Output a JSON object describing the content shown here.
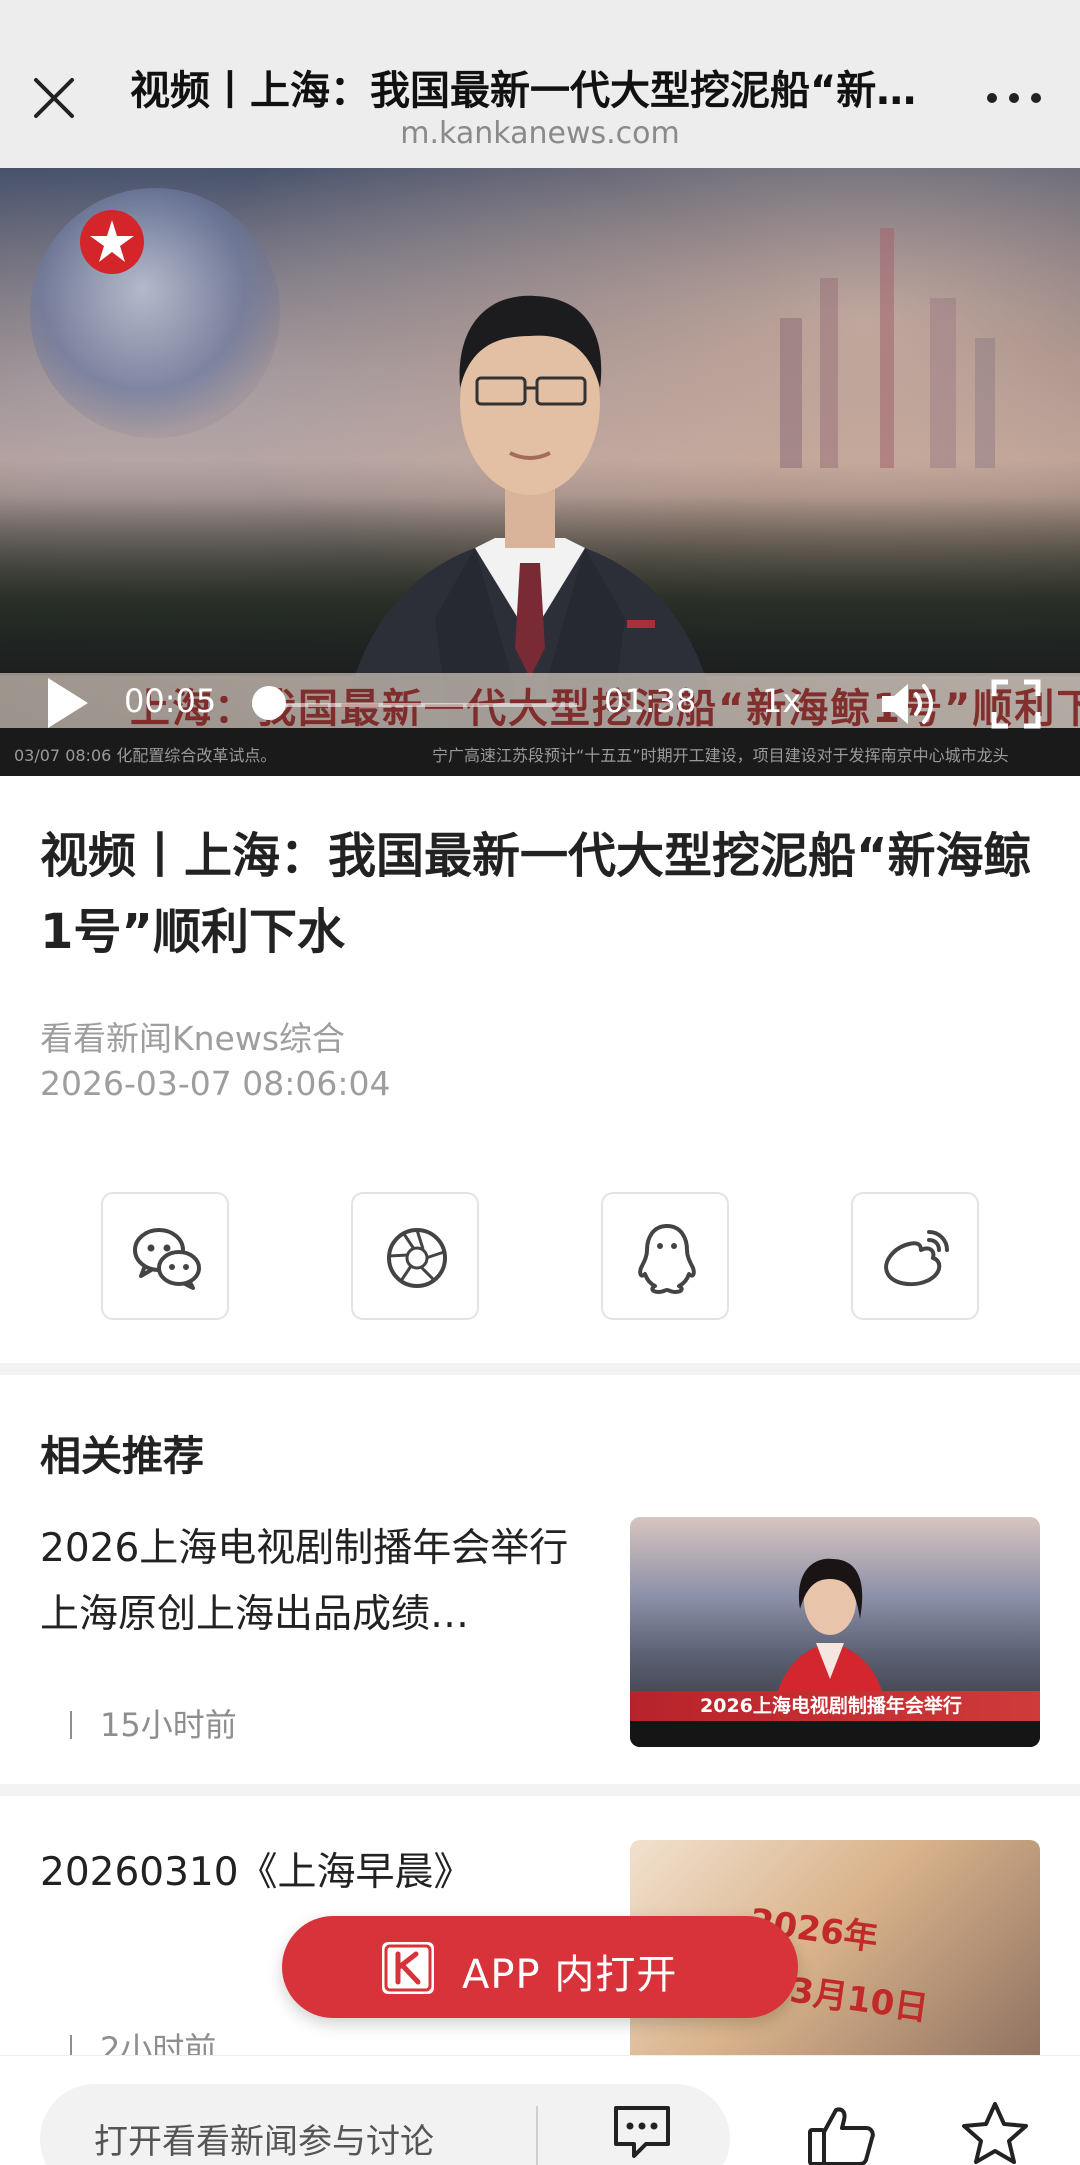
{
  "browser": {
    "page_title": "视频丨上海：我国最新一代大型挖泥船“新海鲸1号”顺利下水",
    "domain": "m.kankanews.com"
  },
  "video": {
    "current_time": "00:05",
    "duration": "01:38",
    "speed": "1x",
    "progress_fraction": 0.051,
    "caption": "上海：我国最新一代大型挖泥船“新海鲸1号”顺利下水",
    "ticker_left": "03/07 08:06 化配置综合改革试点。",
    "ticker_right": "宁广高速江苏段预计“十五五”时期开工建设，项目建设对于发挥南京中心城市龙头"
  },
  "article": {
    "headline": "视频丨上海：我国最新一代大型挖泥船“新海鲸1号”顺利下水",
    "source": "看看新闻Knews综合",
    "date": "2026-03-07 08:06:04"
  },
  "share": {
    "icons": [
      "wechat-icon",
      "moments-icon",
      "qq-icon",
      "weibo-icon"
    ]
  },
  "related": {
    "section_title": "相关推荐",
    "items": [
      {
        "title": "2026上海电视剧制播年会举行 上海原创上海出品成绩…",
        "time": "15小时前",
        "thumb_caption": "2026上海电视剧制播年会举行"
      },
      {
        "title": "20260310《上海早晨》",
        "time": "2小时前",
        "thumb_year": "2026年",
        "thumb_date": "3月10日"
      }
    ]
  },
  "app_button": {
    "label": "APP 内打开"
  },
  "bottom_bar": {
    "input_text": "打开看看新闻参与讨论"
  },
  "colors": {
    "accent_red": "#d8333a",
    "muted_text": "#9e9e9e",
    "toolbar_bg": "#ededed"
  }
}
